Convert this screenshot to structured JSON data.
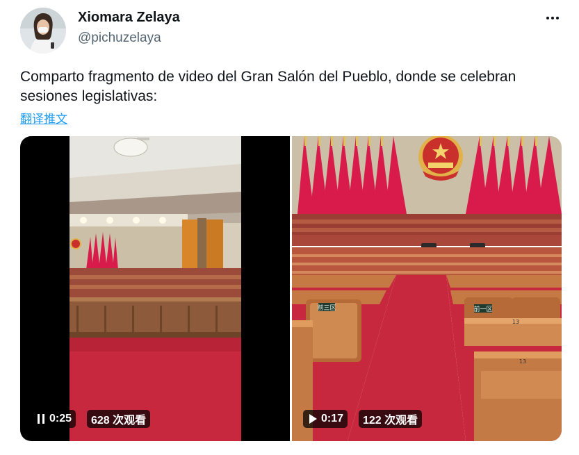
{
  "author": {
    "name": "Xiomara Zelaya",
    "handle": "@pichuzelaya"
  },
  "tweet": {
    "text": "Comparto fragmento de video del Gran Salón del Pueblo, donde se celebran sesiones legislativas:",
    "translate_label": "翻译推文"
  },
  "icons": {
    "more": "more-horizontal-icon",
    "pause": "pause-icon",
    "play": "play-icon"
  },
  "media": [
    {
      "state": "playing",
      "time": "0:25",
      "views": "628 次观看"
    },
    {
      "state": "paused",
      "time": "0:17",
      "views": "122 次观看",
      "desk_labels": [
        "前三区",
        "前一区"
      ],
      "seat_numbers": [
        "13",
        "13"
      ]
    }
  ],
  "colors": {
    "link": "#1d9bf0",
    "text": "#0f1419",
    "secondary": "#536471",
    "carpet": "#c8283e",
    "flag_red": "#d81b4a"
  }
}
